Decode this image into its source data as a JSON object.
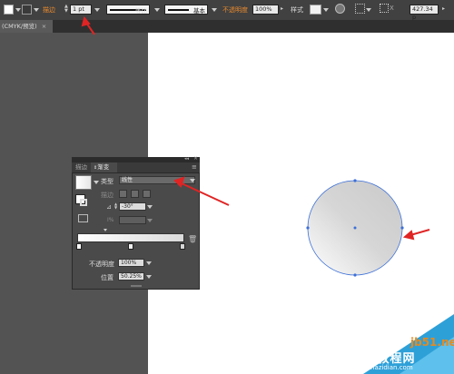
{
  "control_bar": {
    "stroke_label": "描边",
    "stroke_weight": "1 pt",
    "profile_label": "等比",
    "brush_label": "基本",
    "opacity_label": "不透明度",
    "opacity_value": "100%",
    "style_label": "样式",
    "x_value": "427.34 p"
  },
  "document_tab": {
    "label": "(CMYK/预览)",
    "close": "×"
  },
  "gradient_panel": {
    "tabs": [
      "描边",
      "渐变"
    ],
    "type_label": "类型",
    "type_value": "线性",
    "stroke_label": "描边",
    "angle_value": "-30°",
    "aspect_label": "Ⅰ%",
    "opacity_label": "不透明度",
    "opacity_value": "100%",
    "location_label": "位置",
    "location_value": "50.25%",
    "menu_icon": "≡",
    "collapse_icon": "◂◂",
    "close_icon": "×"
  },
  "colors": {
    "accent_orange": "#e88a2e",
    "arrow_red": "#e02424",
    "anchor_blue": "#3b6fd8"
  },
  "watermark": {
    "site": "jb51.net",
    "brand": "查字典 教程网",
    "url": "jiaocheng.chazidian.com"
  }
}
